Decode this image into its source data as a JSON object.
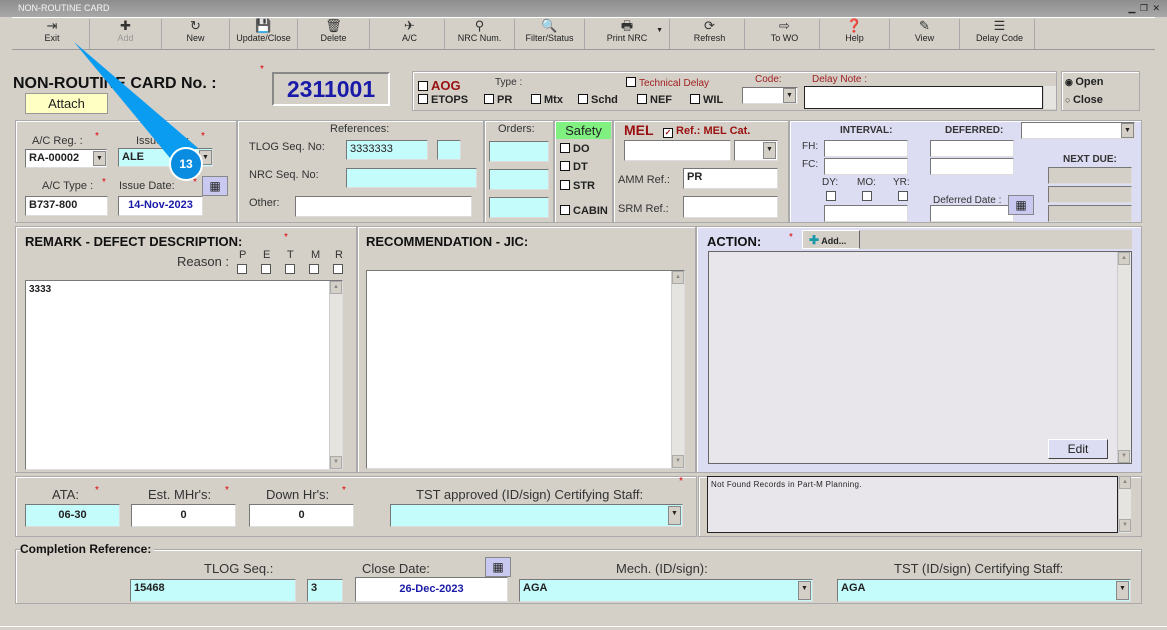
{
  "window": {
    "title": "NON-ROUTINE CARD"
  },
  "toolbar": [
    {
      "label": "Exit",
      "icon": "exit-icon",
      "g": "⇥"
    },
    {
      "label": "Add",
      "icon": "plus-icon",
      "g": "✚"
    },
    {
      "label": "New",
      "icon": "new-icon",
      "g": "↻"
    },
    {
      "label": "Update/Close",
      "icon": "save-icon",
      "g": "💾"
    },
    {
      "label": "Delete",
      "icon": "trash-icon",
      "g": "🗑"
    },
    {
      "label": "A/C",
      "icon": "aircraft-icon",
      "g": "✈"
    },
    {
      "label": "NRC Num.",
      "icon": "nrc-icon",
      "g": "⚲"
    },
    {
      "label": "Filter/Status",
      "icon": "search-icon",
      "g": "🔍"
    },
    {
      "label": "Print NRC",
      "icon": "printer-icon",
      "g": "🖶"
    },
    {
      "label": "Refresh",
      "icon": "refresh-icon",
      "g": "⟳"
    },
    {
      "label": "To WO",
      "icon": "to-wo-icon",
      "g": "⇨"
    },
    {
      "label": "Help",
      "icon": "help-icon",
      "g": "❓"
    },
    {
      "label": "View",
      "icon": "view-icon",
      "g": "✎"
    },
    {
      "label": "Delay Code",
      "icon": "delay-code-icon",
      "g": "☰"
    }
  ],
  "header": {
    "title": "NON-ROUTINE CARD No. :",
    "attach": "Attach",
    "card_no": "2311001",
    "required": "*"
  },
  "type_group": {
    "aog": "AOG",
    "type_label": "Type :",
    "technical_delay": "Technical Delay",
    "code_label": "Code:",
    "delay_note_label": "Delay Note :",
    "etops": "ETOPS",
    "pr": "PR",
    "mtx": "Mtx",
    "schd": "Schd",
    "nef": "NEF",
    "wil": "WIL",
    "code_value": "",
    "delay_note": ""
  },
  "status": {
    "open": "Open",
    "close": "Close",
    "selected": "Open"
  },
  "aircraft": {
    "reg_label": "A/C Reg. :",
    "reg": "RA-00002",
    "issuer_label": "Issued by :",
    "issuer": "ALE",
    "type_label": "A/C Type :",
    "type": "B737-800",
    "issue_date_label": "Issue Date:",
    "issue_date": "14-Nov-2023"
  },
  "references": {
    "title": "References:",
    "tlog_label": "TLOG Seq. No:",
    "tlog": "3333333",
    "nrc_label": "NRC Seq. No:",
    "other_label": "Other:"
  },
  "orders": {
    "title": "Orders:"
  },
  "safety": {
    "title": "Safety",
    "items": [
      "DO",
      "DT",
      "STR",
      "CABIN"
    ]
  },
  "mel": {
    "title": "MEL",
    "ref_label": "Ref.: MEL Cat.",
    "amm_label": "AMM Ref.:",
    "amm": "PR",
    "srm_label": "SRM Ref.:"
  },
  "interval": {
    "interval": "INTERVAL:",
    "deferred": "DEFERRED:",
    "fh": "FH:",
    "fc": "FC:",
    "dy": "DY:",
    "mo": "MO:",
    "yr": "YR:",
    "deferred_date": "Deferred Date :",
    "next_due": "NEXT DUE:"
  },
  "remark": {
    "title": "REMARK - DEFECT DESCRIPTION:",
    "reason": "Reason :",
    "reasons": [
      "P",
      "E",
      "T",
      "M",
      "R"
    ],
    "text": "3333"
  },
  "recommendation": {
    "title": "RECOMMENDATION - JIC:"
  },
  "action": {
    "title": "ACTION:",
    "add": "Add...",
    "edit": "Edit"
  },
  "ata": {
    "ata_label": "ATA:",
    "ata": "06-30",
    "mhrs_label": "Est. MHr's:",
    "mhrs": "0",
    "down_label": "Down Hr's:",
    "down": "0",
    "tst_label": "TST approved (ID/sign) Certifying Staff:"
  },
  "partm": {
    "text": "Not Found Records in Part-M Planning."
  },
  "completion": {
    "title": "Completion Reference:",
    "tlog_label": "TLOG Seq.:",
    "tlog": "15468",
    "tlog2": "3",
    "close_label": "Close Date:",
    "close_date": "26-Dec-2023",
    "mech_label": "Mech. (ID/sign):",
    "mech": "AGA",
    "tst_label": "TST (ID/sign) Certifying Staff:",
    "tst": "AGA"
  },
  "annotation": {
    "step": "13"
  },
  "colors": {
    "accent": "#1a1aa8",
    "cyan": "#c4fbfb",
    "lavender": "#dcdcf2",
    "pointer": "#0a9cf0"
  }
}
